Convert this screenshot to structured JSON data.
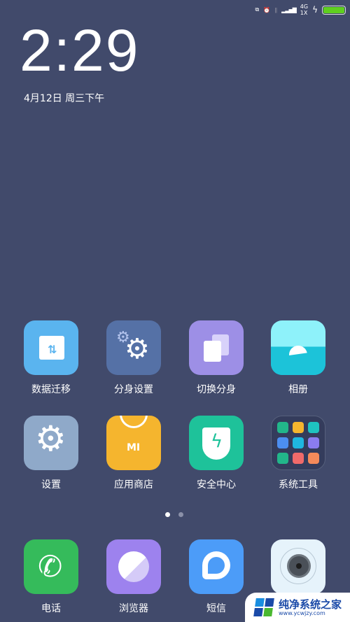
{
  "status_bar": {
    "network_top": "4G",
    "network_bottom": "1X",
    "battery_level": 100,
    "icons": [
      "dual-window-icon",
      "alarm-icon",
      "vibrate-icon",
      "signal-icon",
      "charging-icon",
      "battery-icon"
    ]
  },
  "lockclock": {
    "time": "2:29",
    "date": "4月12日 周三下午"
  },
  "apps": [
    {
      "label": "数据迁移",
      "icon": "data-transfer-icon",
      "color": "#5ab4ef"
    },
    {
      "label": "分身设置",
      "icon": "gears-icon",
      "color": "#5571a6"
    },
    {
      "label": "切换分身",
      "icon": "switch-devices-icon",
      "color": "#9d8fe6"
    },
    {
      "label": "相册",
      "icon": "gallery-icon",
      "color": "#1cc3d9"
    },
    {
      "label": "设置",
      "icon": "settings-icon",
      "color": "#8fa9c9"
    },
    {
      "label": "应用商店",
      "icon": "mi-store-icon",
      "color": "#f5b52e"
    },
    {
      "label": "安全中心",
      "icon": "security-shield-icon",
      "color": "#1ec29a"
    },
    {
      "label": "系统工具",
      "icon": "folder-icon",
      "color": "#343c5c"
    }
  ],
  "page_indicator": {
    "pages": 2,
    "current": 1
  },
  "dock": [
    {
      "label": "电话",
      "icon": "phone-icon",
      "color": "#35bb5b"
    },
    {
      "label": "浏览器",
      "icon": "browser-icon",
      "color": "#9d82ee"
    },
    {
      "label": "短信",
      "icon": "messages-icon",
      "color": "#4c9cf8"
    },
    {
      "label": "",
      "icon": "camera-icon",
      "color": "#e6f3fb"
    }
  ],
  "watermark": {
    "title": "纯净系统之家",
    "url": "www.ycwjzy.com"
  }
}
